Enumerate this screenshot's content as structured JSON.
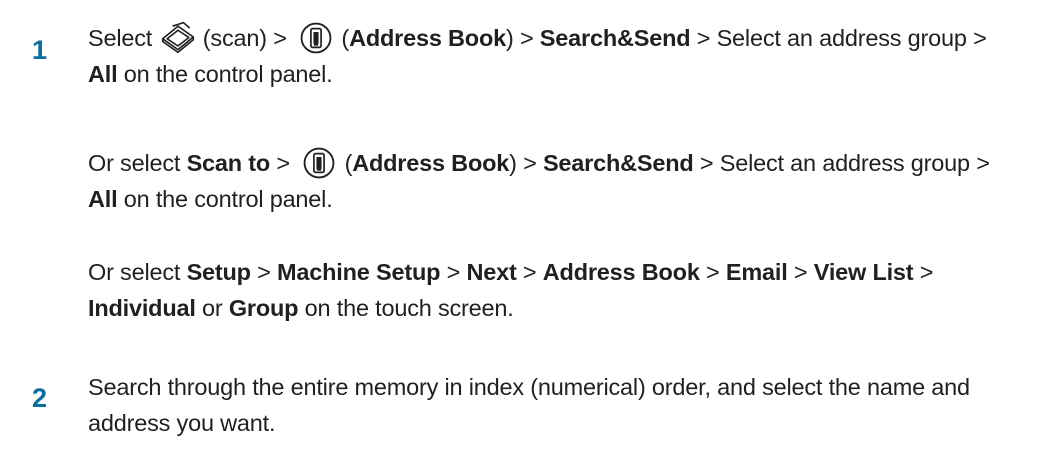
{
  "steps": [
    {
      "number": "1",
      "paragraphs": [
        {
          "segments": [
            {
              "t": "Select "
            },
            {
              "icon": "scan-icon"
            },
            {
              "t": "(scan) > "
            },
            {
              "icon": "address-book-icon"
            },
            {
              "t": " ("
            },
            {
              "b": "Address Book"
            },
            {
              "t": ") > "
            },
            {
              "b": "Search&Send"
            },
            {
              "t": " > Select an address group > "
            },
            {
              "b": "All"
            },
            {
              "t": " on the control panel."
            }
          ]
        },
        {
          "segments": [
            {
              "t": "Or select "
            },
            {
              "b": "Scan to"
            },
            {
              "t": " > "
            },
            {
              "icon": "address-book-icon"
            },
            {
              "t": " ("
            },
            {
              "b": "Address Book"
            },
            {
              "t": ") > "
            },
            {
              "b": "Search&Send"
            },
            {
              "t": " > Select an address group > "
            },
            {
              "b": "All"
            },
            {
              "t": " on the control panel."
            }
          ]
        },
        {
          "segments": [
            {
              "t": "Or select "
            },
            {
              "b": "Setup"
            },
            {
              "t": " > "
            },
            {
              "b": "Machine Setup"
            },
            {
              "t": " > "
            },
            {
              "b": "Next"
            },
            {
              "t": " > "
            },
            {
              "b": "Address Book"
            },
            {
              "t": " > "
            },
            {
              "b": "Email"
            },
            {
              "t": " > "
            },
            {
              "b": "View List"
            },
            {
              "t": " > "
            },
            {
              "b": "Individual"
            },
            {
              "t": " or "
            },
            {
              "b": "Group"
            },
            {
              "t": " on the touch screen."
            }
          ]
        }
      ]
    },
    {
      "number": "2",
      "paragraphs": [
        {
          "segments": [
            {
              "t": " Search through the entire memory in index (numerical) order, and select the name and address you want."
            }
          ]
        }
      ]
    }
  ],
  "colors": {
    "step_number": "#0a6ea3",
    "text": "#231f20"
  }
}
